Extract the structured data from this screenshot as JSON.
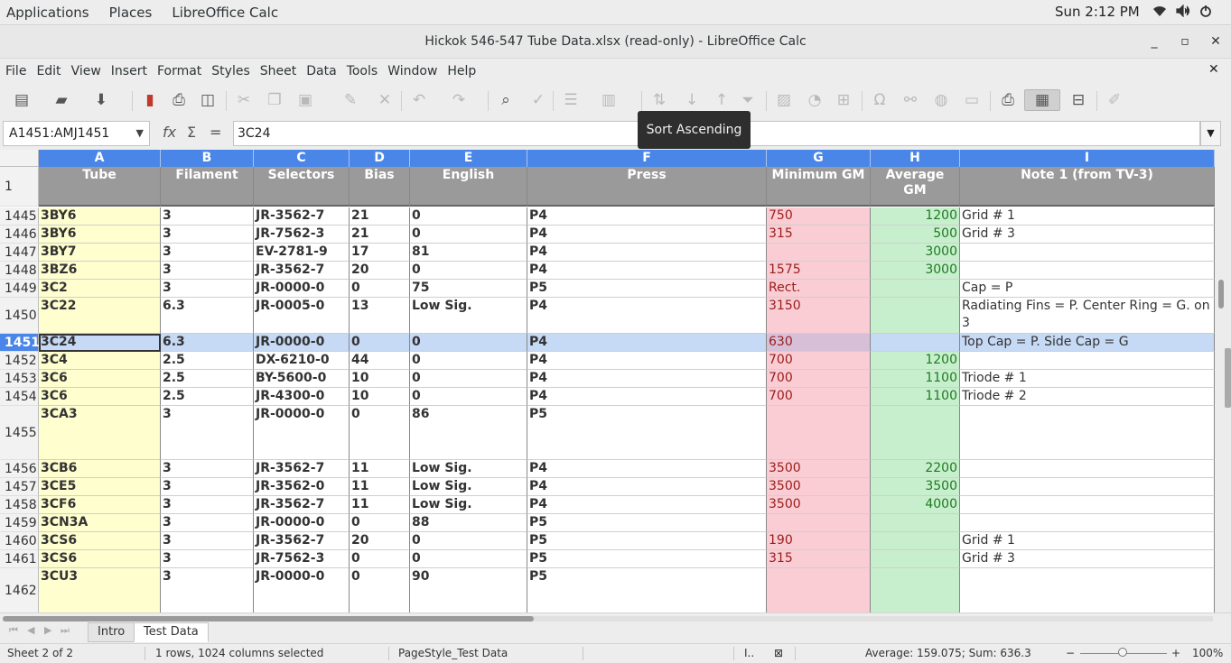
{
  "system": {
    "menus": [
      "Applications",
      "Places",
      "LibreOffice Calc"
    ],
    "clock": "Sun  2:12 PM",
    "tray_icons": [
      "wifi-icon",
      "volume-icon",
      "power-icon"
    ]
  },
  "window": {
    "title": "Hickok 546-547 Tube Data.xlsx (read-only) - LibreOffice Calc",
    "minimize": "_",
    "maximize": "▫",
    "close": "✕"
  },
  "menubar": {
    "items": [
      "File",
      "Edit",
      "View",
      "Insert",
      "Format",
      "Styles",
      "Sheet",
      "Data",
      "Tools",
      "Window",
      "Help"
    ],
    "close": "✕"
  },
  "tooltip": "Sort Ascending",
  "formula_bar": {
    "name_box": "A1451:AMJ1451",
    "content": "3C24"
  },
  "columns": [
    "A",
    "B",
    "C",
    "D",
    "E",
    "F",
    "G",
    "H",
    "I"
  ],
  "header_row": {
    "number": "1",
    "cells": [
      "Tube",
      "Filament",
      "Selectors",
      "Bias",
      "English",
      "Press",
      "Minimum GM",
      "Average GM",
      "Note 1 (from TV-3)"
    ]
  },
  "rows": [
    {
      "n": "1445",
      "c": [
        "3BY6",
        "3",
        "JR-3562-7",
        "21",
        "0",
        "P4",
        "750",
        "1200",
        "Grid # 1"
      ]
    },
    {
      "n": "1446",
      "c": [
        "3BY6",
        "3",
        "JR-7562-3",
        "21",
        "0",
        "P4",
        "315",
        "500",
        "Grid # 3"
      ]
    },
    {
      "n": "1447",
      "c": [
        "3BY7",
        "3",
        "EV-2781-9",
        "17",
        "81",
        "P4",
        "",
        "3000",
        ""
      ]
    },
    {
      "n": "1448",
      "c": [
        "3BZ6",
        "3",
        "JR-3562-7",
        "20",
        "0",
        "P4",
        "1575",
        "3000",
        ""
      ]
    },
    {
      "n": "1449",
      "c": [
        "3C2",
        "3",
        "JR-0000-0",
        "0",
        "75",
        "P5",
        "Rect.",
        "",
        "Cap = P"
      ]
    },
    {
      "n": "1450",
      "c": [
        "3C22",
        "6.3",
        "JR-0005-0",
        "13",
        "Low Sig.",
        "P4",
        "3150",
        "",
        "Radiating Fins = P. Center Ring = G. on 3"
      ]
    },
    {
      "n": "1451",
      "c": [
        "3C24",
        "6.3",
        "JR-0000-0",
        "0",
        "0",
        "P4",
        "630",
        "",
        "Top Cap = P. Side Cap = G"
      ],
      "selected": true
    },
    {
      "n": "1452",
      "c": [
        "3C4",
        "2.5",
        "DX-6210-0",
        "44",
        "0",
        "P4",
        "700",
        "1200",
        ""
      ]
    },
    {
      "n": "1453",
      "c": [
        "3C6",
        "2.5",
        "BY-5600-0",
        "10",
        "0",
        "P4",
        "700",
        "1100",
        "Triode # 1"
      ]
    },
    {
      "n": "1454",
      "c": [
        "3C6",
        "2.5",
        "JR-4300-0",
        "10",
        "0",
        "P4",
        "700",
        "1100",
        "Triode # 2"
      ]
    },
    {
      "n": "1455",
      "c": [
        "3CA3",
        "3",
        "JR-0000-0",
        "0",
        "86",
        "P5",
        "",
        "",
        ""
      ]
    },
    {
      "n": "1456",
      "c": [
        "3CB6",
        "3",
        "JR-3562-7",
        "11",
        "Low Sig.",
        "P4",
        "3500",
        "2200",
        ""
      ]
    },
    {
      "n": "1457",
      "c": [
        "3CE5",
        "3",
        "JR-3562-0",
        "11",
        "Low Sig.",
        "P4",
        "3500",
        "3500",
        ""
      ]
    },
    {
      "n": "1458",
      "c": [
        "3CF6",
        "3",
        "JR-3562-7",
        "11",
        "Low Sig.",
        "P4",
        "3500",
        "4000",
        ""
      ]
    },
    {
      "n": "1459",
      "c": [
        "3CN3A",
        "3",
        "JR-0000-0",
        "0",
        "88",
        "P5",
        "",
        "",
        ""
      ]
    },
    {
      "n": "1460",
      "c": [
        "3CS6",
        "3",
        "JR-3562-7",
        "20",
        "0",
        "P5",
        "190",
        "",
        "Grid # 1"
      ]
    },
    {
      "n": "1461",
      "c": [
        "3CS6",
        "3",
        "JR-7562-3",
        "0",
        "0",
        "P5",
        "315",
        "",
        "Grid # 3"
      ]
    },
    {
      "n": "1462",
      "c": [
        "3CU3",
        "3",
        "JR-0000-0",
        "0",
        "90",
        "P5",
        "",
        "",
        ""
      ]
    }
  ],
  "sheets": [
    "Intro",
    "Test Data"
  ],
  "active_sheet": "Test Data",
  "status": {
    "sheet": "Sheet 2 of 2",
    "selection": "1 rows, 1024 columns selected",
    "page_style": "PageStyle_Test Data",
    "summary": "Average: 159.075; Sum: 636.3",
    "zoom": "100%",
    "zoom_minus": "−",
    "zoom_plus": "+"
  }
}
